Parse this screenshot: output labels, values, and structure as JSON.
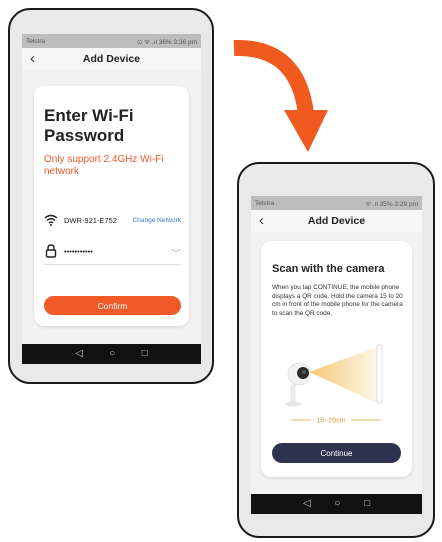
{
  "colors": {
    "accent": "#f05a28",
    "link": "#3a78c8",
    "dark_button": "#2e3450",
    "range_label": "#e8a13a"
  },
  "phone1": {
    "status": {
      "carrier": "Telstra",
      "right": "⊙ ᯤ .ıl 36% 3:36 pm"
    },
    "appbar": {
      "back": "‹",
      "title": "Add Device"
    },
    "card": {
      "title": "Enter Wi-Fi Password",
      "note": "Only support 2.4GHz Wi-Fi network",
      "wifi_icon": "wifi-icon",
      "network_name": "DWR-921-E752",
      "change_network": "Change Network",
      "lock_icon": "lock-icon",
      "password_masked": "•••••••••••",
      "eye_icon": "eye-hidden-icon",
      "confirm": "Confirm"
    },
    "nav": {
      "back": "◁",
      "home": "○",
      "recents": "□"
    }
  },
  "phone2": {
    "status": {
      "carrier": "Telstra",
      "right": "ᯤ .ıl 35% 3:29 pm"
    },
    "appbar": {
      "back": "‹",
      "title": "Add Device"
    },
    "card": {
      "title": "Scan with the camera",
      "body": "When you tap CONTINUE, the mobile phone displays a QR code. Hold the camera 15 to 20 cm in front of the mobile phone for the camera to scan the QR code.",
      "distance_label": "15~20cm",
      "continue": "Continue"
    },
    "nav": {
      "back": "◁",
      "home": "○",
      "recents": "□"
    }
  }
}
